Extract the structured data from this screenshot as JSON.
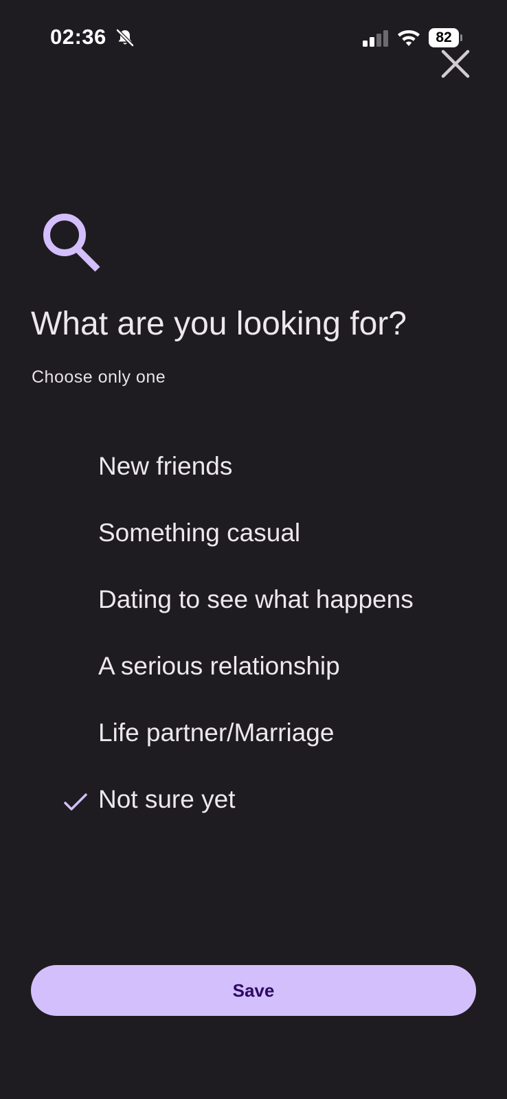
{
  "status_bar": {
    "time": "02:36",
    "battery": "82",
    "icons": [
      "bell-slash-icon",
      "cellular-signal-icon",
      "wifi-icon",
      "battery-icon"
    ]
  },
  "header": {
    "close_icon": "close-icon"
  },
  "main": {
    "icon": "search-icon",
    "title": "What are you looking for?",
    "subtitle": "Choose only one",
    "options": [
      {
        "label": "New friends",
        "selected": false
      },
      {
        "label": "Something casual",
        "selected": false
      },
      {
        "label": "Dating to see what happens",
        "selected": false
      },
      {
        "label": "A serious relationship",
        "selected": false
      },
      {
        "label": "Life partner/Marriage",
        "selected": false
      },
      {
        "label": "Not sure yet",
        "selected": true
      }
    ]
  },
  "footer": {
    "save_label": "Save"
  },
  "colors": {
    "background": "#1e1c20",
    "accent": "#d4bffd",
    "button_text": "#2d0a63",
    "text": "#ece8ee"
  }
}
